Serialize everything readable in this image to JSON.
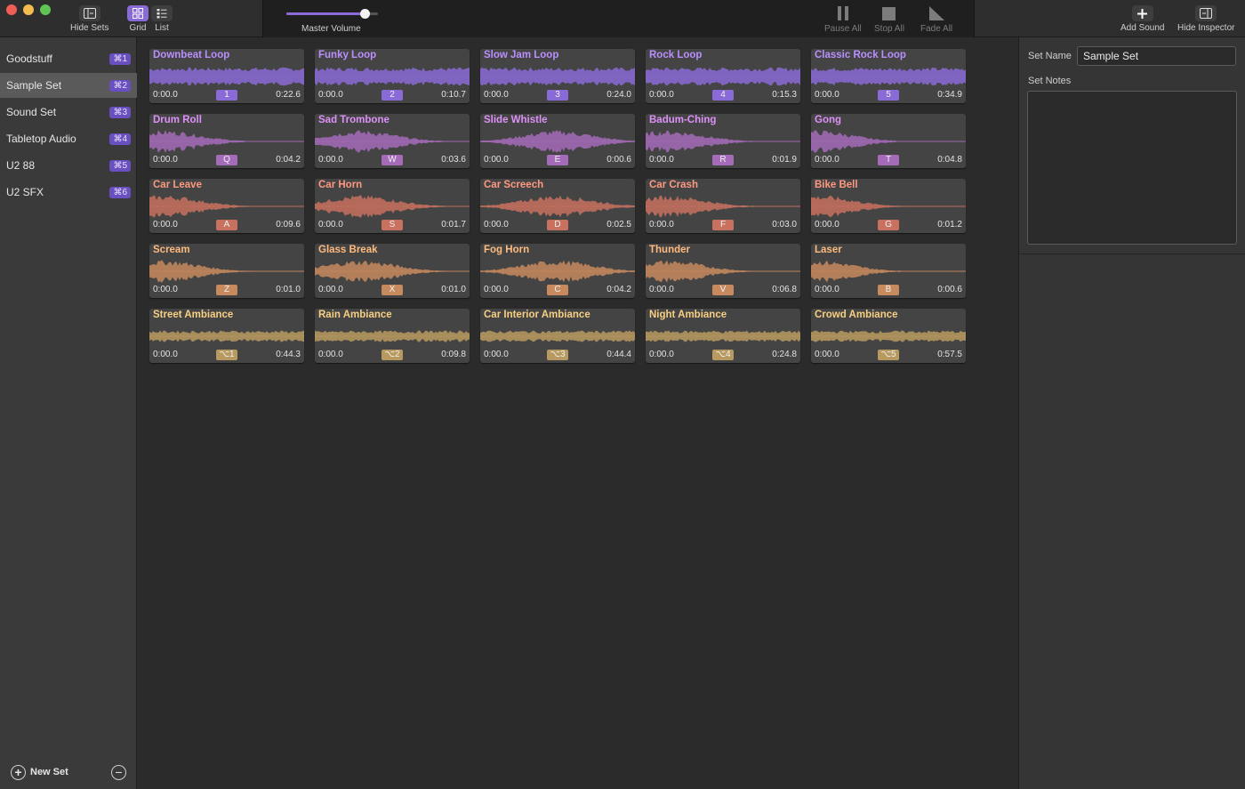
{
  "toolbar": {
    "hide_sets": "Hide Sets",
    "grid": "Grid",
    "list": "List",
    "master_volume": "Master Volume",
    "master_volume_level": 0.85,
    "pause_all": "Pause All",
    "stop_all": "Stop All",
    "fade_all": "Fade All",
    "add_sound": "Add Sound",
    "hide_inspector": "Hide Inspector"
  },
  "sidebar": {
    "sets": [
      {
        "name": "Goodstuff",
        "shortcut": "⌘1"
      },
      {
        "name": "Sample Set",
        "shortcut": "⌘2",
        "selected": true
      },
      {
        "name": "Sound Set",
        "shortcut": "⌘3"
      },
      {
        "name": "Tabletop Audio",
        "shortcut": "⌘4"
      },
      {
        "name": "U2 88",
        "shortcut": "⌘5"
      },
      {
        "name": "U2 SFX",
        "shortcut": "⌘6"
      }
    ],
    "new_set": "New Set"
  },
  "colors": {
    "purple": "#8a6ad6",
    "violet": "#a36bb8",
    "salmon": "#c8715f",
    "orange": "#c78a5e",
    "tan": "#b89a60"
  },
  "sounds": [
    {
      "name": "Downbeat Loop",
      "start": "0:00.0",
      "key": "1",
      "duration": "0:22.6",
      "color": "purple"
    },
    {
      "name": "Funky Loop",
      "start": "0:00.0",
      "key": "2",
      "duration": "0:10.7",
      "color": "purple"
    },
    {
      "name": "Slow Jam Loop",
      "start": "0:00.0",
      "key": "3",
      "duration": "0:24.0",
      "color": "purple"
    },
    {
      "name": "Rock Loop",
      "start": "0:00.0",
      "key": "4",
      "duration": "0:15.3",
      "color": "purple"
    },
    {
      "name": "Classic Rock Loop",
      "start": "0:00.0",
      "key": "5",
      "duration": "0:34.9",
      "color": "purple"
    },
    {
      "name": "Drum Roll",
      "start": "0:00.0",
      "key": "Q",
      "duration": "0:04.2",
      "color": "violet"
    },
    {
      "name": "Sad Trombone",
      "start": "0:00.0",
      "key": "W",
      "duration": "0:03.6",
      "color": "violet"
    },
    {
      "name": "Slide Whistle",
      "start": "0:00.0",
      "key": "E",
      "duration": "0:00.6",
      "color": "violet"
    },
    {
      "name": "Badum-Ching",
      "start": "0:00.0",
      "key": "R",
      "duration": "0:01.9",
      "color": "violet"
    },
    {
      "name": "Gong",
      "start": "0:00.0",
      "key": "T",
      "duration": "0:04.8",
      "color": "violet"
    },
    {
      "name": "Car Leave",
      "start": "0:00.0",
      "key": "A",
      "duration": "0:09.6",
      "color": "salmon"
    },
    {
      "name": "Car Horn",
      "start": "0:00.0",
      "key": "S",
      "duration": "0:01.7",
      "color": "salmon"
    },
    {
      "name": "Car Screech",
      "start": "0:00.0",
      "key": "D",
      "duration": "0:02.5",
      "color": "salmon"
    },
    {
      "name": "Car Crash",
      "start": "0:00.0",
      "key": "F",
      "duration": "0:03.0",
      "color": "salmon"
    },
    {
      "name": "Bike Bell",
      "start": "0:00.0",
      "key": "G",
      "duration": "0:01.2",
      "color": "salmon"
    },
    {
      "name": "Scream",
      "start": "0:00.0",
      "key": "Z",
      "duration": "0:01.0",
      "color": "orange"
    },
    {
      "name": "Glass Break",
      "start": "0:00.0",
      "key": "X",
      "duration": "0:01.0",
      "color": "orange"
    },
    {
      "name": "Fog Horn",
      "start": "0:00.0",
      "key": "C",
      "duration": "0:04.2",
      "color": "orange"
    },
    {
      "name": "Thunder",
      "start": "0:00.0",
      "key": "V",
      "duration": "0:06.8",
      "color": "orange"
    },
    {
      "name": "Laser",
      "start": "0:00.0",
      "key": "B",
      "duration": "0:00.6",
      "color": "orange"
    },
    {
      "name": "Street Ambiance",
      "start": "0:00.0",
      "key": "⌥1",
      "duration": "0:44.3",
      "color": "tan"
    },
    {
      "name": "Rain Ambiance",
      "start": "0:00.0",
      "key": "⌥2",
      "duration": "0:09.8",
      "color": "tan"
    },
    {
      "name": "Car Interior Ambiance",
      "start": "0:00.0",
      "key": "⌥3",
      "duration": "0:44.4",
      "color": "tan"
    },
    {
      "name": "Night Ambiance",
      "start": "0:00.0",
      "key": "⌥4",
      "duration": "0:24.8",
      "color": "tan"
    },
    {
      "name": "Crowd Ambiance",
      "start": "0:00.0",
      "key": "⌥5",
      "duration": "0:57.5",
      "color": "tan"
    }
  ],
  "inspector": {
    "set_name_label": "Set Name",
    "set_name_value": "Sample Set",
    "set_notes_label": "Set Notes",
    "set_notes_value": ""
  }
}
